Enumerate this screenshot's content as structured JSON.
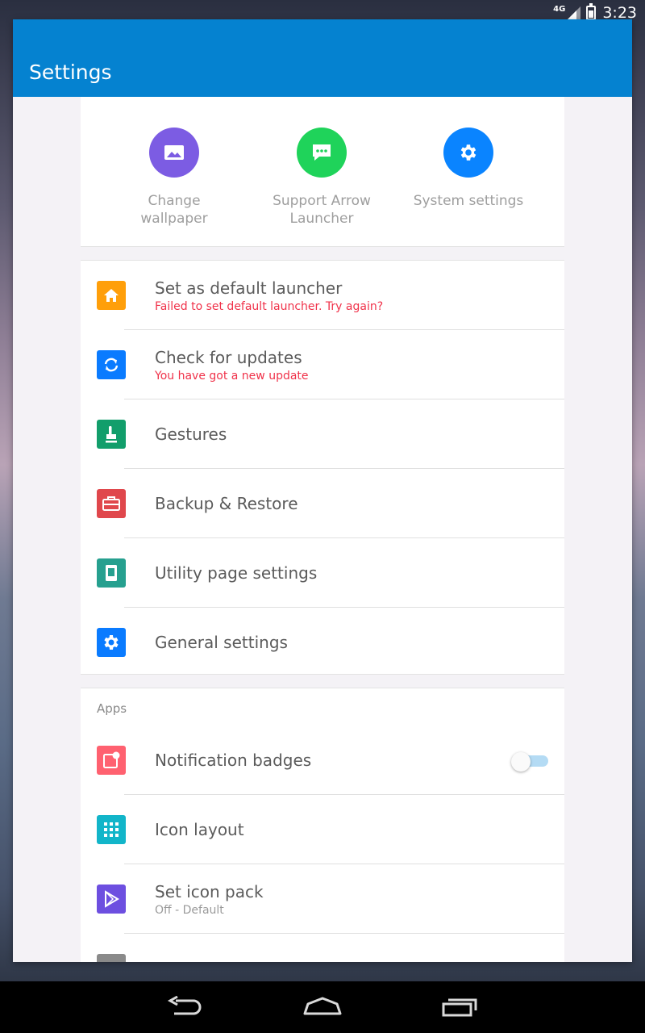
{
  "status_bar": {
    "network": "4G",
    "time": "3:23"
  },
  "app_bar": {
    "title": "Settings"
  },
  "quick_actions": [
    {
      "label_line1": "Change",
      "label_line2": "wallpaper",
      "icon": "image-icon",
      "color": "#7c5ce3"
    },
    {
      "label_line1": "Support Arrow",
      "label_line2": "Launcher",
      "icon": "chat-icon",
      "color": "#1fd35a"
    },
    {
      "label_line1": "System settings",
      "label_line2": "",
      "icon": "gear-icon",
      "color": "#0a84ff"
    }
  ],
  "settings": [
    {
      "title": "Set as default launcher",
      "subtitle": "Failed to set default launcher. Try again?",
      "icon": "home-icon",
      "color": "#ff9f0a"
    },
    {
      "title": "Check for updates",
      "subtitle": "You have got a new update",
      "icon": "sync-icon",
      "color": "#0a7bff"
    },
    {
      "title": "Gestures",
      "subtitle": "",
      "icon": "gesture-hand-icon",
      "color": "#129e6b"
    },
    {
      "title": "Backup & Restore",
      "subtitle": "",
      "icon": "toolbox-icon",
      "color": "#e0474c"
    },
    {
      "title": "Utility page settings",
      "subtitle": "",
      "icon": "page-icon",
      "color": "#26a08f"
    },
    {
      "title": "General settings",
      "subtitle": "",
      "icon": "gear-icon",
      "color": "#0a7bff"
    }
  ],
  "apps_section": {
    "header": "Apps",
    "items": [
      {
        "title": "Notification badges",
        "subtitle": "",
        "icon": "badge-icon",
        "color": "#ff6170",
        "toggle_on": false
      },
      {
        "title": "Icon layout",
        "subtitle": "",
        "icon": "grid-icon",
        "color": "#12b5c9"
      },
      {
        "title": "Set icon pack",
        "subtitle": "Off - Default",
        "icon": "play-store-icon",
        "color": "#6d4fe0"
      }
    ]
  },
  "nav_bar": {
    "back": "back-icon",
    "home": "home-nav-icon",
    "recents": "recents-icon"
  }
}
